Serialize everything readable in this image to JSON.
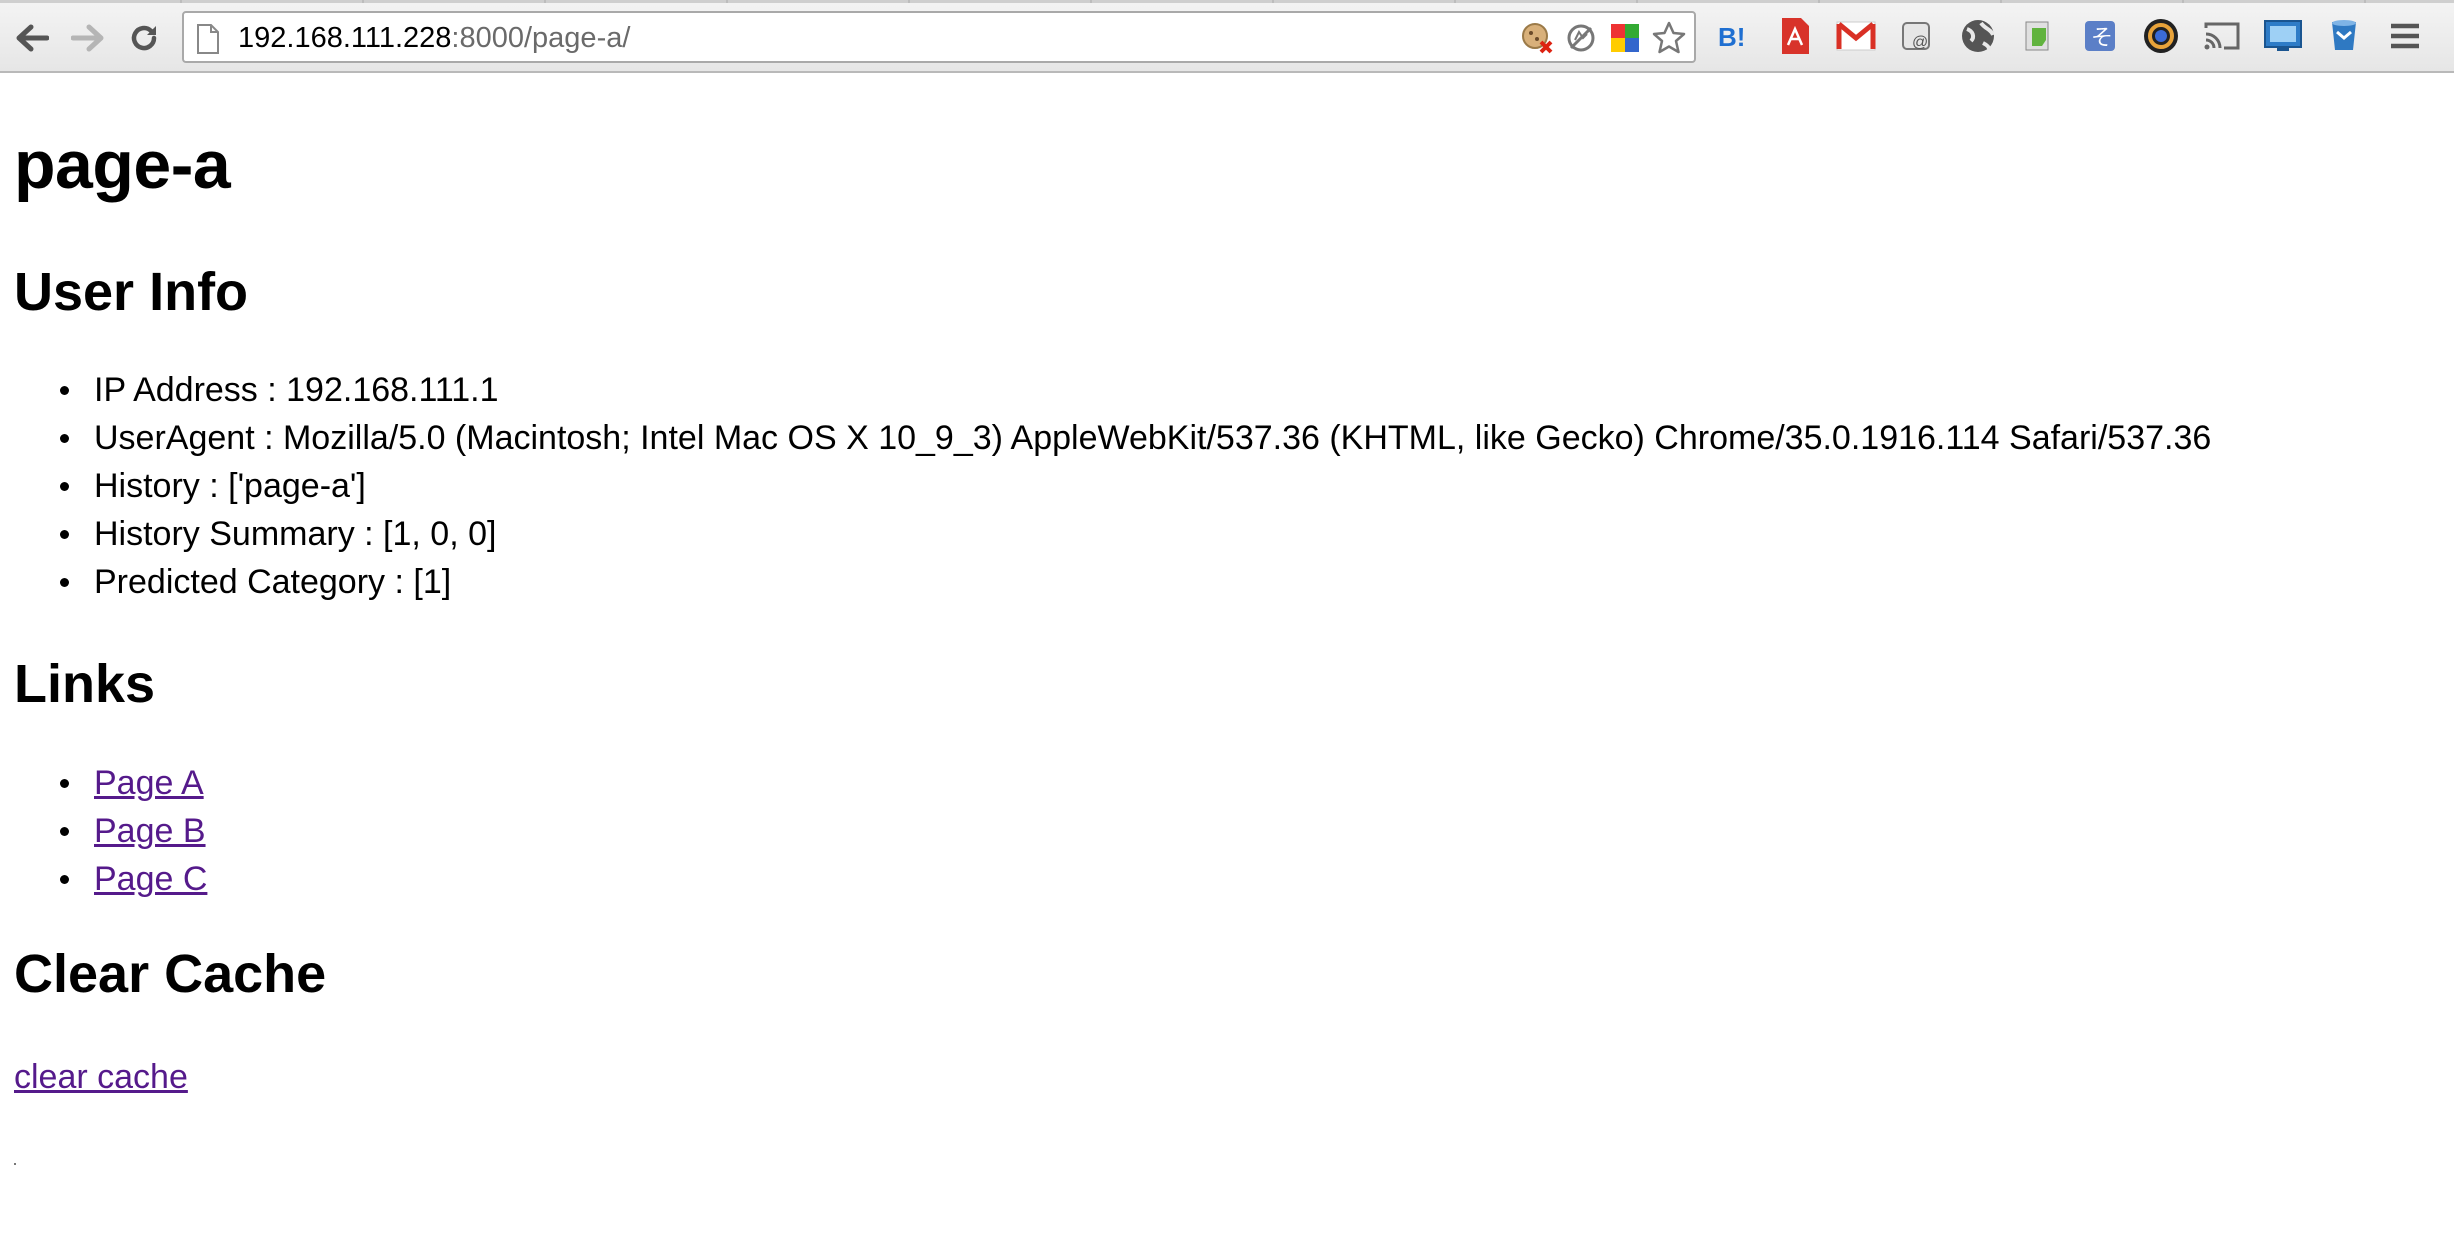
{
  "browser": {
    "url_host": "192.168.111.228",
    "url_rest": ":8000/page-a/",
    "icons": [
      "back-arrow-icon",
      "forward-arrow-icon",
      "reload-icon",
      "page-icon",
      "cookie-blocked-icon",
      "no-tracking-icon",
      "color-picker-icon",
      "bookmark-star-icon",
      "hatena-bookmark-icon",
      "pdf-icon",
      "gmail-icon",
      "mail-checker-icon",
      "globe-icon",
      "evernote-icon",
      "translate-icon",
      "camera-icon",
      "cast-icon",
      "screenshot-icon",
      "pocket-icon",
      "menu-icon"
    ]
  },
  "page": {
    "title": "page-a",
    "user_info_heading": "User Info",
    "user_info": [
      "IP Address : 192.168.111.1",
      "UserAgent : Mozilla/5.0 (Macintosh; Intel Mac OS X 10_9_3) AppleWebKit/537.36 (KHTML, like Gecko) Chrome/35.0.1916.114 Safari/537.36",
      "History : ['page-a']",
      "History Summary : [1, 0, 0]",
      "Predicted Category : [1]"
    ],
    "links_heading": "Links",
    "links": [
      "Page A",
      "Page B",
      "Page C"
    ],
    "clear_heading": "Clear Cache",
    "clear_link": "clear cache"
  },
  "colors": {
    "link": "#551a8b",
    "toolbar": "#e6e6e6"
  }
}
